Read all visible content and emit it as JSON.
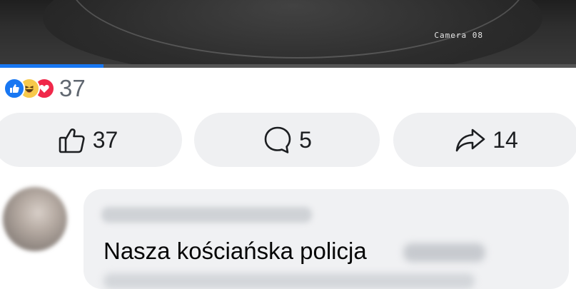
{
  "video": {
    "camera_label": "Camera 08",
    "progress_fraction": 0.18
  },
  "reactions": {
    "icons": [
      "like-reaction-icon",
      "haha-reaction-icon",
      "love-reaction-icon"
    ],
    "count": "37"
  },
  "actions": {
    "like": {
      "icon": "thumbs-up-icon",
      "count": "37"
    },
    "comment": {
      "icon": "comment-bubble-icon",
      "count": "5"
    },
    "share": {
      "icon": "share-arrow-icon",
      "count": "14"
    }
  },
  "comment": {
    "text": "Nasza kościańska policja"
  },
  "colors": {
    "accent": "#1877f2",
    "love": "#f0284a",
    "haha": "#f7c94a",
    "button_bg": "#eff0f2"
  }
}
